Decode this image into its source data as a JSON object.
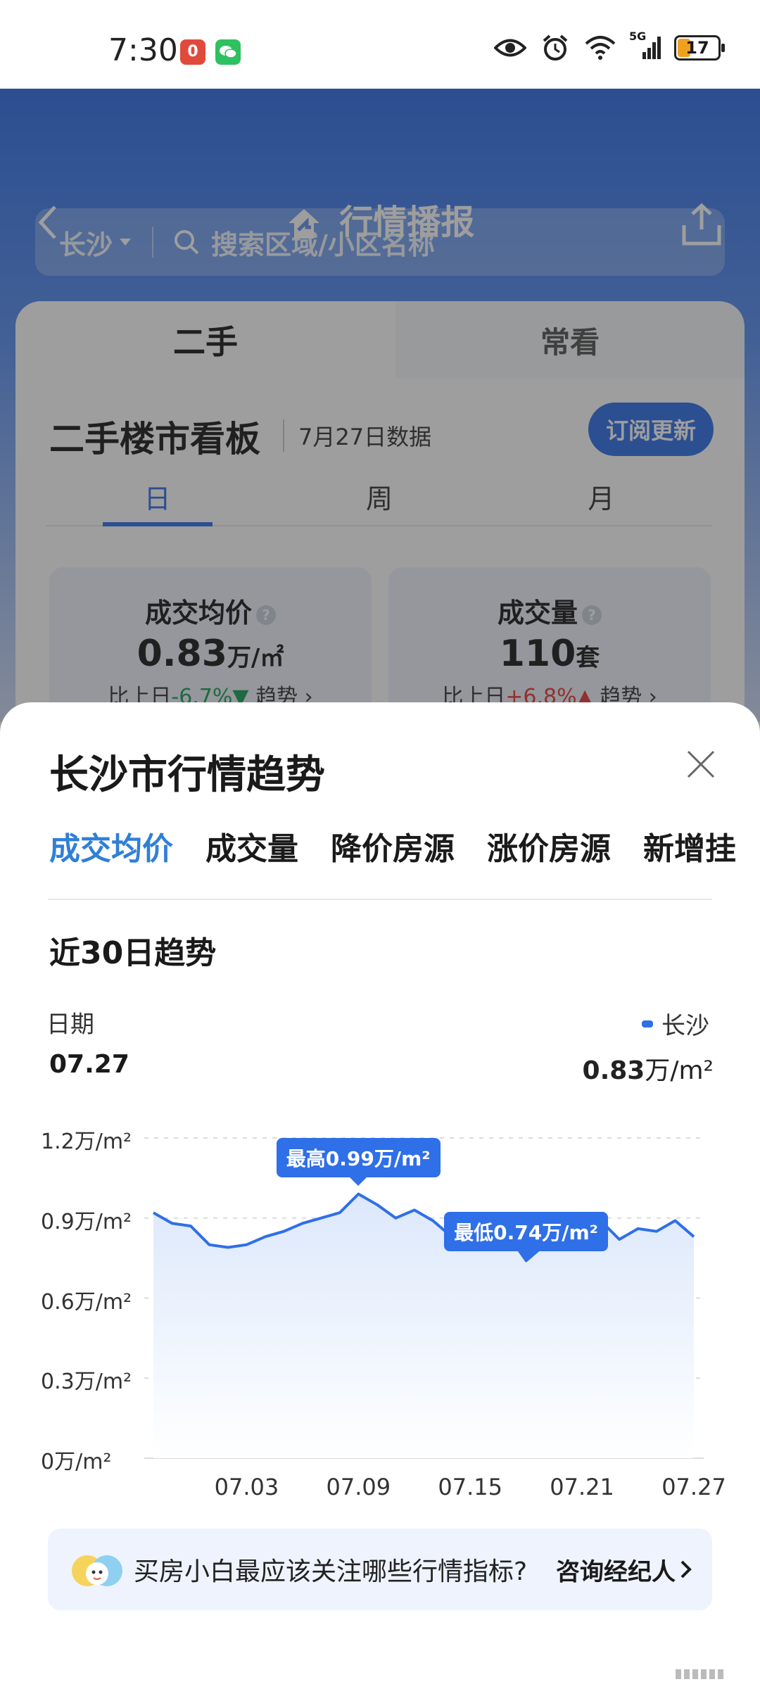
{
  "status_bar": {
    "time": "7:30",
    "app_badge_red": "0",
    "network": "5G",
    "battery": "17",
    "colors": {
      "red_badge": "#e04a3b",
      "green_badge": "#2dc160"
    },
    "icons": [
      "eye-icon",
      "alarm-icon",
      "wifi-icon",
      "signal-icon",
      "battery-icon"
    ]
  },
  "header": {
    "title": "行情播报",
    "search": {
      "city": "长沙",
      "placeholder": "搜索区域/小区名称"
    }
  },
  "panel": {
    "tabs": [
      "二手",
      "常看"
    ],
    "board_title": "二手楼市看板",
    "data_date": "7月27日数据",
    "subscribe_label": "订阅更新",
    "period_tabs": [
      "日",
      "周",
      "月"
    ],
    "kpis": [
      {
        "name": "成交均价",
        "value": "0.83",
        "unit": "万/㎡",
        "compare_prefix": "比上日",
        "compare": "-6.7%▼",
        "trend": "趋势 ›"
      },
      {
        "name": "成交量",
        "value": "110",
        "unit": "套",
        "compare_prefix": "比上日",
        "compare": "+6.8%▲",
        "trend": "趋势 ›"
      }
    ]
  },
  "sheet": {
    "title": "长沙市行情趋势",
    "metric_tabs": [
      "成交均价",
      "成交量",
      "降价房源",
      "涨价房源",
      "新增挂"
    ],
    "trend_title": "近30日趋势",
    "date_label": "日期",
    "date_value": "07.27",
    "legend_name": "长沙",
    "legend_value": "0.83",
    "legend_unit": "万/m²",
    "max_label": "最高0.99万/m²",
    "min_label": "最低0.74万/m²",
    "tip_text": "买房小白最应该关注哪些行情指标?",
    "tip_link": "咨询经纪人"
  },
  "chart_data": {
    "type": "area",
    "y_ticks": [
      "1.2万/m²",
      "0.9万/m²",
      "0.6万/m²",
      "0.3万/m²",
      "0万/m²"
    ],
    "x_ticks": [
      "07.03",
      "07.09",
      "07.15",
      "07.21",
      "07.27"
    ],
    "ylim": [
      0,
      1.2
    ],
    "series": [
      {
        "name": "长沙",
        "color": "#2f6fe8",
        "x": [
          "06.28",
          "06.29",
          "06.30",
          "07.01",
          "07.02",
          "07.03",
          "07.04",
          "07.05",
          "07.06",
          "07.07",
          "07.08",
          "07.09",
          "07.10",
          "07.11",
          "07.12",
          "07.13",
          "07.14",
          "07.15",
          "07.16",
          "07.17",
          "07.18",
          "07.19",
          "07.20",
          "07.21",
          "07.22",
          "07.23",
          "07.24",
          "07.25",
          "07.26",
          "07.27"
        ],
        "values": [
          0.92,
          0.88,
          0.87,
          0.8,
          0.79,
          0.8,
          0.83,
          0.85,
          0.88,
          0.9,
          0.92,
          0.99,
          0.95,
          0.9,
          0.93,
          0.89,
          0.83,
          0.85,
          0.88,
          0.84,
          0.74,
          0.8,
          0.85,
          0.87,
          0.89,
          0.82,
          0.86,
          0.85,
          0.89,
          0.83
        ]
      }
    ]
  }
}
